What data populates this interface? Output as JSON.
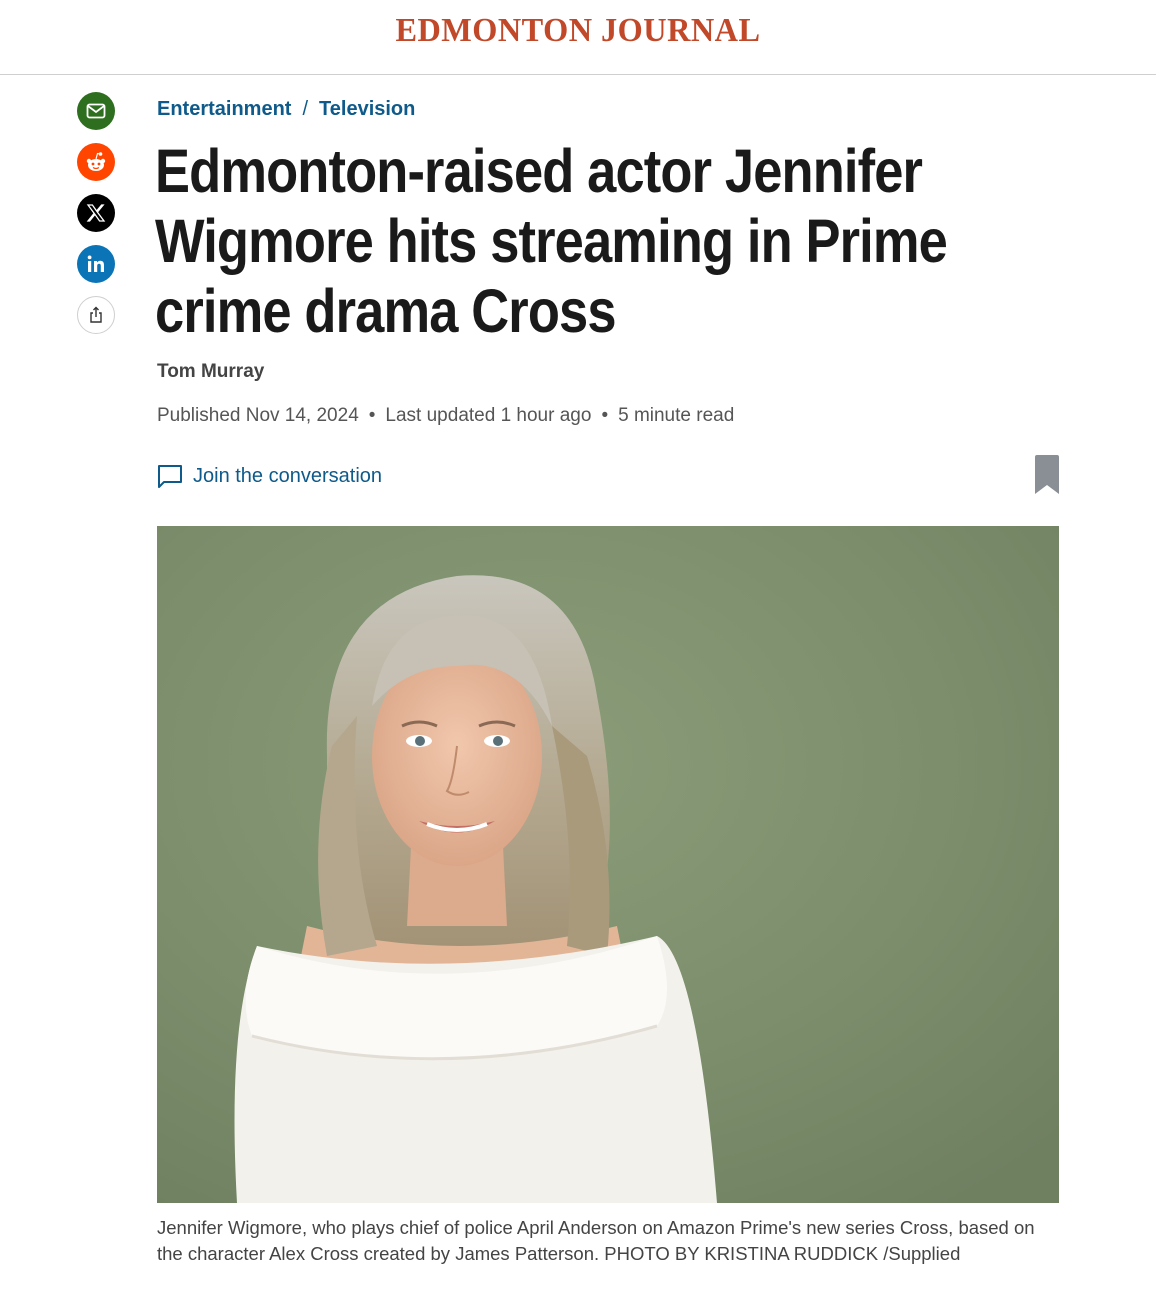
{
  "masthead": {
    "logo_text": "Edmonton Journal",
    "brand_color": "#c1492a"
  },
  "share": {
    "items": [
      {
        "name": "email",
        "icon": "email-icon",
        "color": "#2e6e1f"
      },
      {
        "name": "reddit",
        "icon": "reddit-icon",
        "color": "#ff4500"
      },
      {
        "name": "x",
        "icon": "x-icon",
        "color": "#000000"
      },
      {
        "name": "linkedin",
        "icon": "linkedin-icon",
        "color": "#0a74b7"
      },
      {
        "name": "more",
        "icon": "share-icon",
        "color": "#ffffff"
      }
    ]
  },
  "breadcrumb": {
    "section": "Entertainment",
    "separator": "/",
    "subsection": "Television"
  },
  "article": {
    "headline": "Edmonton-raised actor Jennifer Wigmore hits streaming in Prime crime drama Cross",
    "author": "Tom Murray",
    "published": "Published Nov 14, 2024",
    "updated": "Last updated 1 hour ago",
    "read_time": "5 minute read",
    "separator": "•",
    "join_label": "Join the conversation",
    "caption": "Jennifer Wigmore, who plays chief of police April Anderson on Amazon Prime's new series Cross, based on the character Alex Cross created by James Patterson. PHOTO BY KRISTINA RUDDICK /Supplied"
  },
  "colors": {
    "link": "#0e5a8a",
    "headline": "#1a1a1a",
    "photo_bg": "#7b8d6c"
  }
}
